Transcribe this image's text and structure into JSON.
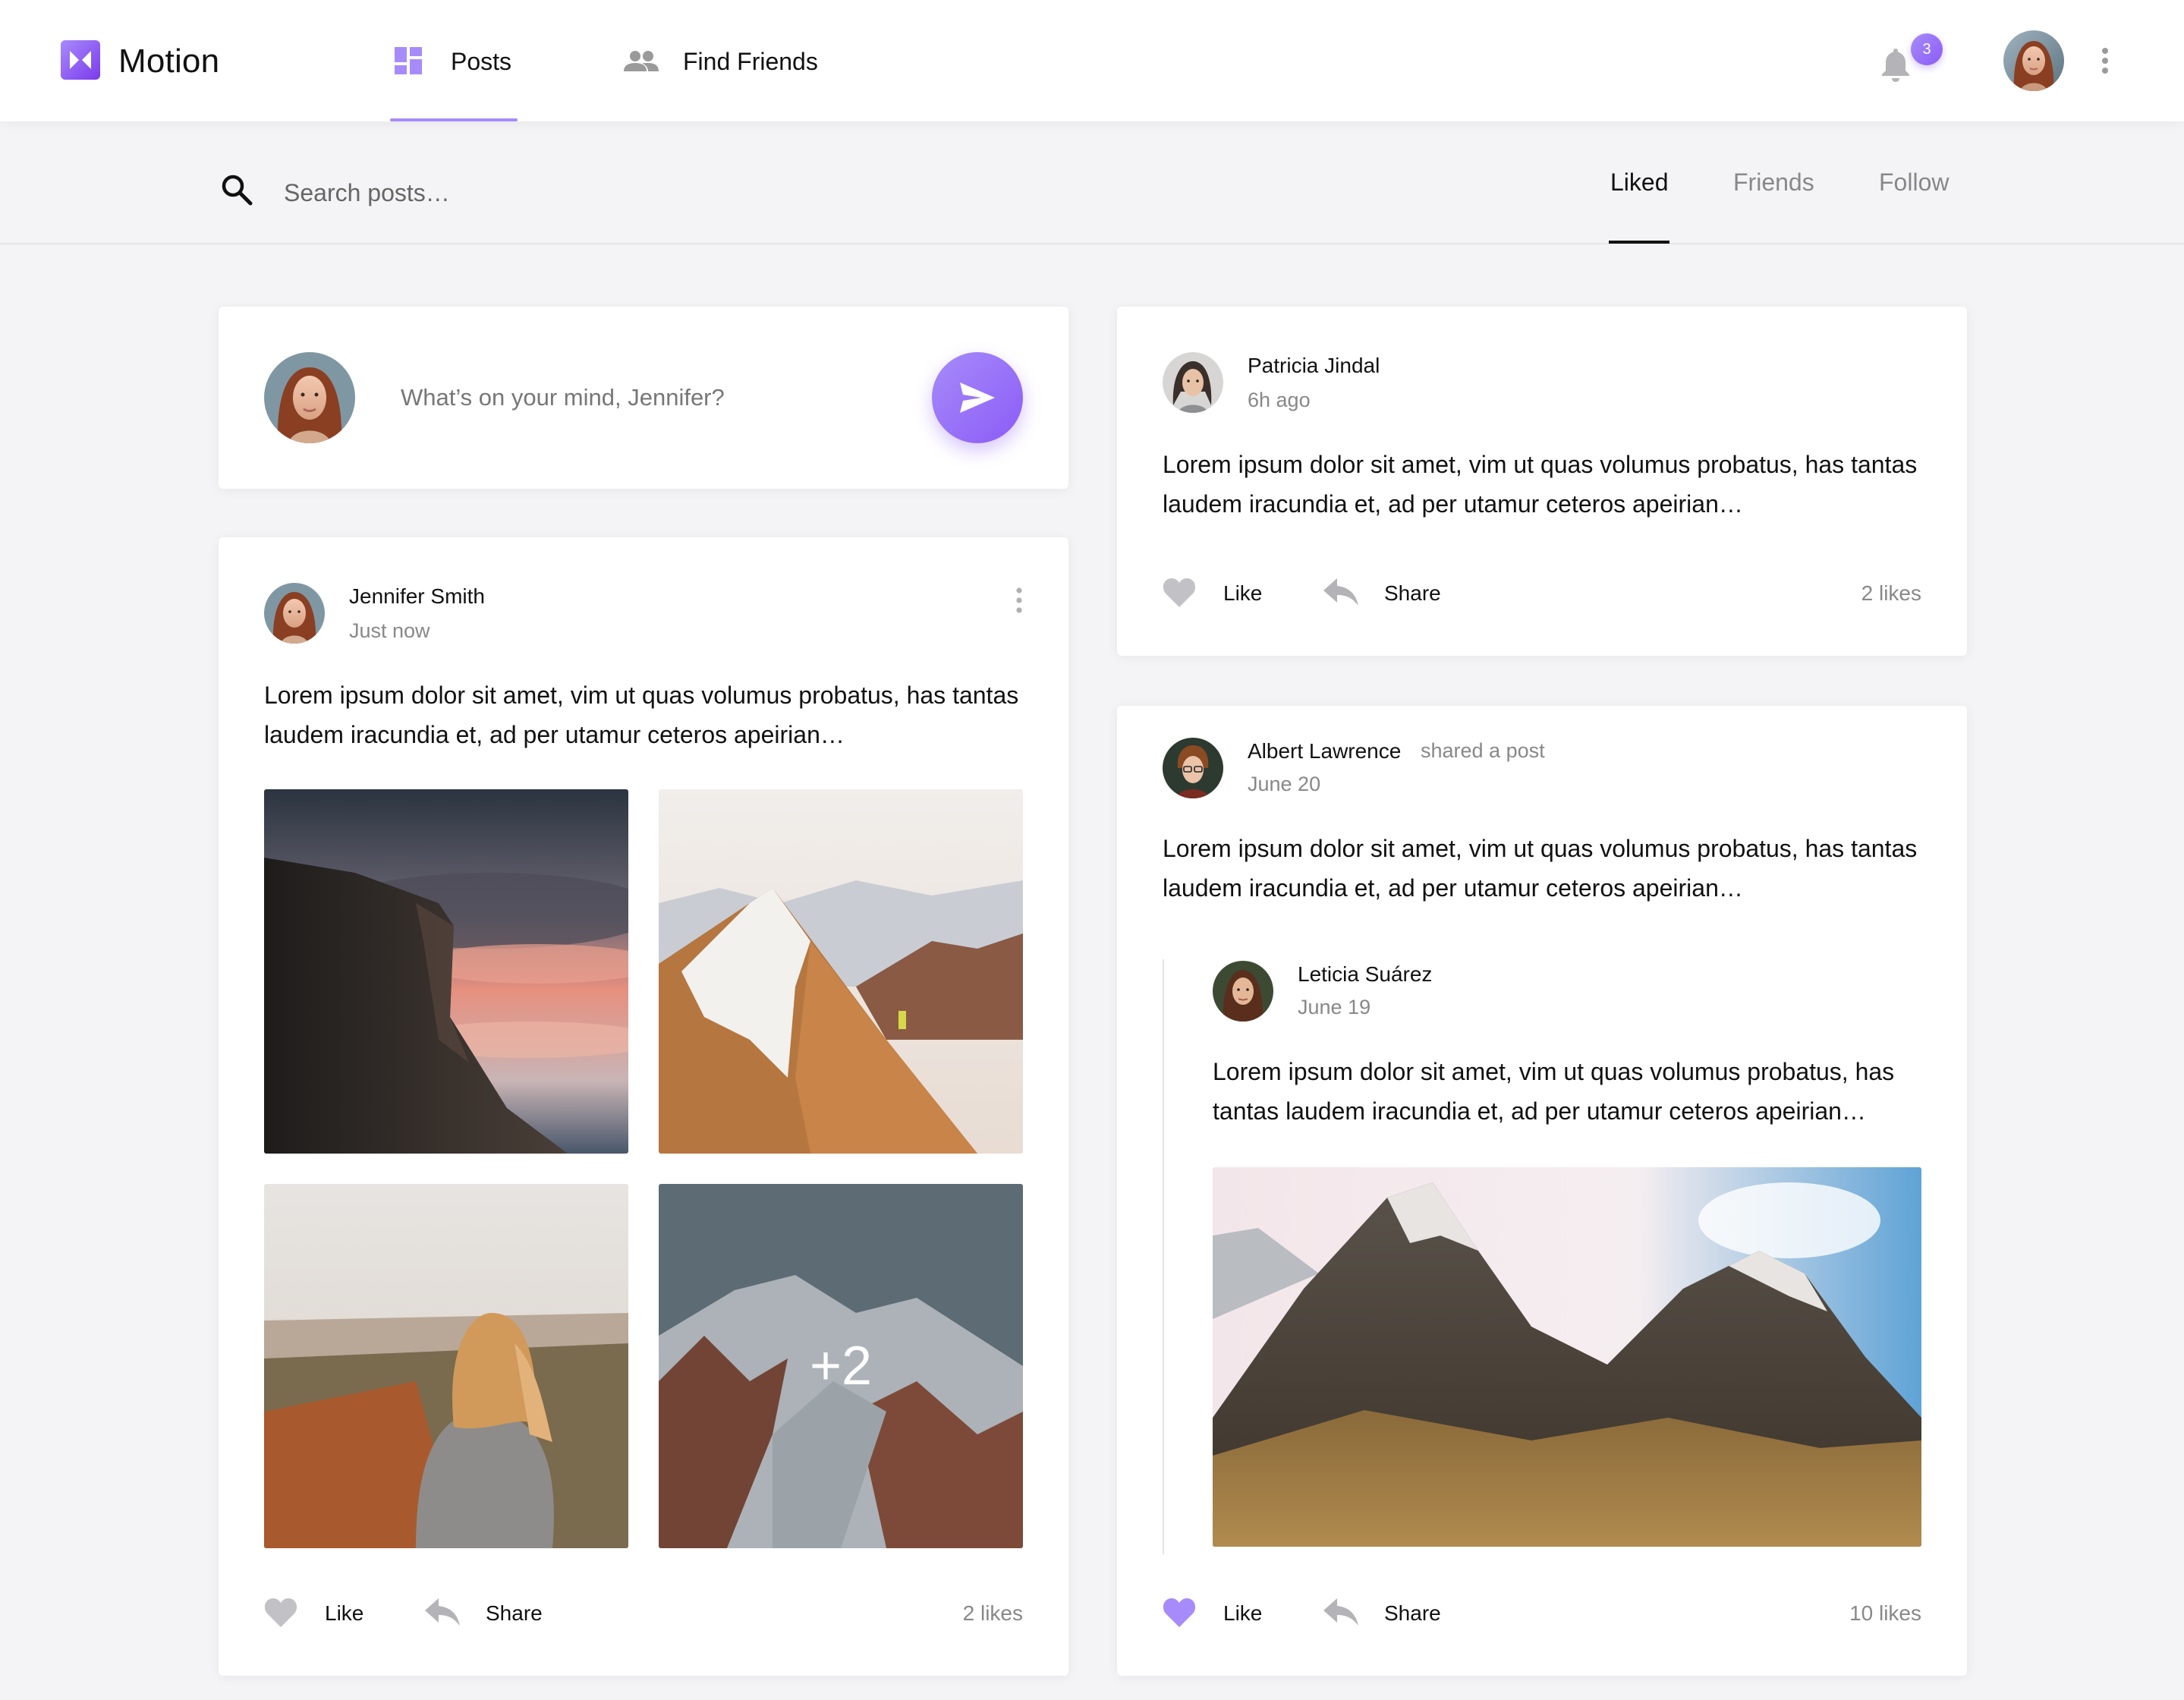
{
  "app": {
    "name": "Motion"
  },
  "nav": {
    "tabs": [
      {
        "label": "Posts",
        "icon": "dashboard-icon",
        "active": true
      },
      {
        "label": "Find Friends",
        "icon": "people-icon",
        "active": false
      }
    ],
    "notifications_count": "3",
    "accent_color": "#a78bfa"
  },
  "search": {
    "placeholder": "Search posts…"
  },
  "filters": [
    {
      "label": "Liked",
      "active": true
    },
    {
      "label": "Friends",
      "active": false
    },
    {
      "label": "Follow",
      "active": false
    }
  ],
  "composer": {
    "placeholder": "What’s on your mind, Jennifer?"
  },
  "posts": [
    {
      "author": "Jennifer Smith",
      "time": "Just now",
      "text_line1": "Lorem ipsum dolor sit amet, vim ut quas volumus probatus, has tantas",
      "text_line2": "laudem iracundia et, ad per utamur ceteros apeirian…",
      "more_images": "+2",
      "like_label": "Like",
      "share_label": "Share",
      "likes": "2 likes",
      "liked": false
    },
    {
      "author": "Patricia Jindal",
      "time": "6h ago",
      "text_line1": "Lorem ipsum dolor sit amet, vim ut quas volumus probatus, has tantas",
      "text_line2": "laudem iracundia et, ad per utamur ceteros apeirian…",
      "like_label": "Like",
      "share_label": "Share",
      "likes": "2 likes",
      "liked": false
    },
    {
      "author": "Albert Lawrence",
      "action": "shared a post",
      "time": "June 20",
      "text_line1": "Lorem ipsum dolor sit amet, vim ut quas volumus probatus, has tantas",
      "text_line2": "laudem iracundia et, ad per utamur ceteros apeirian…",
      "shared": {
        "author": "Leticia Suárez",
        "time": "June 19",
        "text_line1": "Lorem ipsum dolor sit amet, vim ut quas volumus probatus, has",
        "text_line2": "tantas laudem iracundia et, ad per utamur ceteros apeirian…"
      },
      "like_label": "Like",
      "share_label": "Share",
      "likes": "10 likes",
      "liked": true
    }
  ]
}
